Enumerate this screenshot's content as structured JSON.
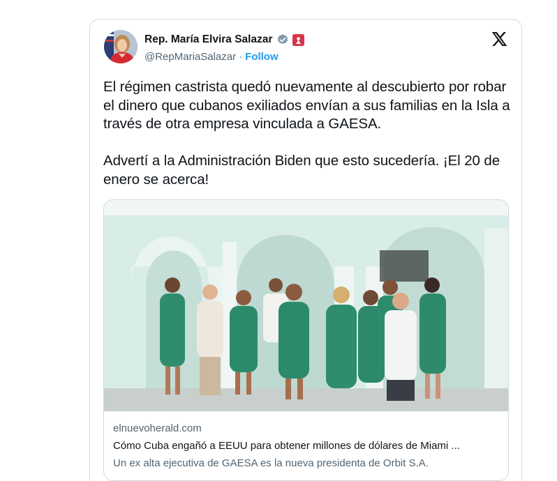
{
  "author": {
    "name": "Rep. María Elvira Salazar",
    "handle": "@RepMariaSalazar",
    "separator": "·",
    "follow_label": "Follow",
    "avatar_icon": "profile-photo",
    "verified_icon": "verified-gray-badge-icon",
    "affiliation_icon": "us-house-badge-icon"
  },
  "platform_icon": "x-logo-icon",
  "tweet": {
    "text": "El régimen castrista quedó nuevamente al descubierto por robar el dinero que cubanos exiliados envían a sus familias en la Isla a través de otra empresa vinculada a GAESA.\n\nAdvertí a la Administración Biden que esto sucedería. ¡El 20 de enero se acerca!"
  },
  "link_card": {
    "image_icon": "group-photo",
    "domain": "elnuevoherald.com",
    "title": "Cómo Cuba engañó a EEUU para obtener millones de dólares de Miami ...",
    "description": "Un ex alta ejecutiva de GAESA es la nueva presidenta de Orbit S.A."
  },
  "colors": {
    "follow": "#1d9bf0",
    "secondary_text": "#536471",
    "border": "#cfd9de",
    "badge_red": "#d8344a"
  }
}
